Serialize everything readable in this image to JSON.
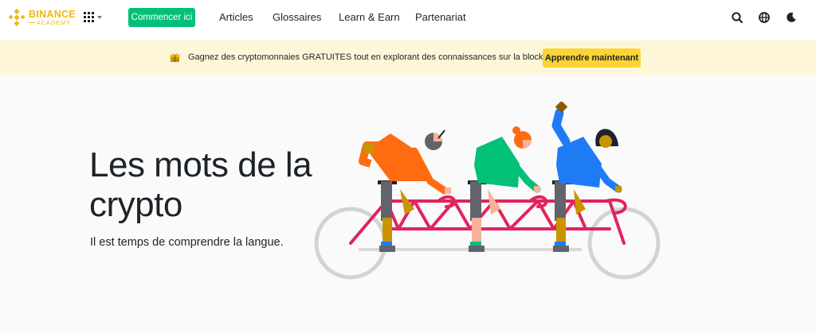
{
  "header": {
    "logo_main": "BINANCE",
    "logo_sub": "ACADEMY",
    "cta_label": "Commencer ici",
    "nav": [
      {
        "label": "Articles"
      },
      {
        "label": "Glossaires"
      },
      {
        "label": "Learn & Earn"
      },
      {
        "label": "Partenariat"
      }
    ],
    "icons": [
      "search-icon",
      "globe-icon",
      "dark-mode-icon"
    ]
  },
  "banner": {
    "text": "Gagnez des cryptomonnaies GRATUITES tout en explorant des connaissances sur la blockchain",
    "button_label": "Apprendre maintenant",
    "icon": "gift-icon"
  },
  "hero": {
    "title": "Les mots de la crypto",
    "subtitle": "Il est temps de comprendre la langue.",
    "illustration": "tandem-bicycle-illustration"
  },
  "colors": {
    "brand": "#F0B90B",
    "cta_green": "#02C076",
    "banner_bg": "#FDF7D8",
    "banner_button": "#FCD535",
    "hero_bg": "#FAFAFA",
    "text": "#1E2329"
  }
}
